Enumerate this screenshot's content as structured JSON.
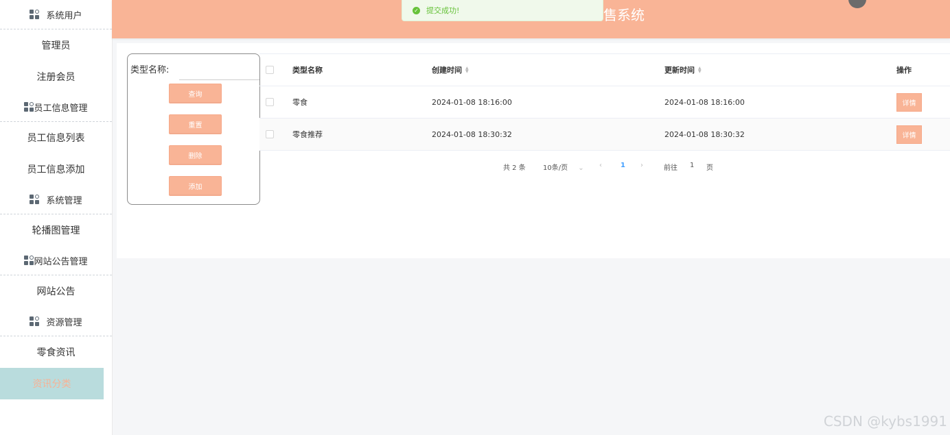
{
  "sidebar": {
    "groups": [
      {
        "label": "系统用户",
        "items": [
          "管理员",
          "注册会员"
        ]
      },
      {
        "label": "员工信息管理",
        "items": [
          "员工信息列表",
          "员工信息添加"
        ]
      },
      {
        "label": "系统管理",
        "items": [
          "轮播图管理"
        ]
      },
      {
        "label": "网站公告管理",
        "items": [
          "网站公告"
        ]
      },
      {
        "label": "资源管理",
        "items": [
          "零食资讯",
          "资讯分类"
        ]
      }
    ]
  },
  "header": {
    "title": "售系统"
  },
  "toast": {
    "message": "提交成功!"
  },
  "search": {
    "label": "类型名称:",
    "value": "",
    "buttons": {
      "query": "查询",
      "reset": "重置",
      "delete": "删除",
      "add": "添加"
    }
  },
  "table": {
    "headers": {
      "name": "类型名称",
      "created": "创建时间",
      "updated": "更新时间",
      "action": "操作"
    },
    "rows": [
      {
        "name": "零食",
        "created": "2024-01-08 18:16:00",
        "updated": "2024-01-08 18:16:00",
        "action": "详情"
      },
      {
        "name": "零食推荐",
        "created": "2024-01-08 18:30:32",
        "updated": "2024-01-08 18:30:32",
        "action": "详情"
      }
    ]
  },
  "pagination": {
    "total": "共 2 条",
    "page_size": "10条/页",
    "current": "1",
    "goto_label": "前往",
    "goto_value": "1",
    "page_suffix": "页"
  },
  "watermark": "CSDN @kybs1991",
  "colors": {
    "accent": "#f9b496",
    "active_bg": "#b9dcdd",
    "success": "#67c23a",
    "link": "#409eff"
  }
}
